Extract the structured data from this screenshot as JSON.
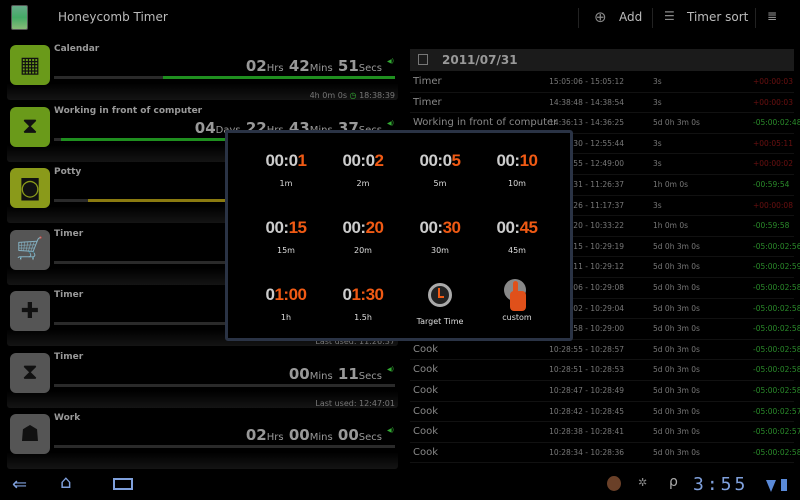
{
  "action_bar": {
    "title": "Honeycomb Timer",
    "add_label": "Add",
    "sort_label": "Timer sort"
  },
  "timers": [
    {
      "name": "Calendar",
      "icon": "calendar-icon",
      "color": "#6a9a1a",
      "parts": [
        [
          "02",
          "Hrs"
        ],
        [
          "42",
          "Mins"
        ],
        [
          "51",
          "Secs"
        ]
      ],
      "progress": 0.68,
      "bar_color": "#1f8f1f",
      "footer_left": "4h 0m 0s",
      "footer_right": "18:38:39"
    },
    {
      "name": "Working in front of computer",
      "icon": "hourglass-icon",
      "color": "#6a9a1a",
      "parts": [
        [
          "04",
          "Days"
        ],
        [
          "22",
          "Hrs"
        ],
        [
          "43",
          "Mins"
        ],
        [
          "37",
          "Secs"
        ]
      ],
      "progress": 0.98,
      "bar_color": "#1f8f1f",
      "footer_left": "",
      "footer_right": ""
    },
    {
      "name": "Potty",
      "icon": "toilet-paper-icon",
      "color": "#8a9a1a",
      "parts": [],
      "progress": 0.9,
      "bar_color": "#8a7a10",
      "footer_left": "",
      "footer_right": ""
    },
    {
      "name": "Timer",
      "icon": "cart-icon",
      "color": "#555",
      "parts": [],
      "progress": 0,
      "bar_color": "#333",
      "footer_left": "",
      "footer_right": ""
    },
    {
      "name": "Timer",
      "icon": "first-aid-kit-icon",
      "color": "#555",
      "parts": [],
      "progress": 0,
      "bar_color": "#333",
      "footer_left": "",
      "footer_right": "Last used: 11:26:37"
    },
    {
      "name": "Timer",
      "icon": "hourglass-icon",
      "color": "#555",
      "parts": [
        [
          "00",
          "Mins"
        ],
        [
          "11",
          "Secs"
        ]
      ],
      "progress": 0,
      "bar_color": "#333",
      "footer_left": "",
      "footer_right": "Last used: 12:47:01"
    },
    {
      "name": "Work",
      "icon": "worker-icon",
      "color": "#555",
      "parts": [
        [
          "02",
          "Hrs"
        ],
        [
          "00",
          "Mins"
        ],
        [
          "00",
          "Secs"
        ]
      ],
      "progress": 0,
      "bar_color": "#333",
      "footer_left": "",
      "footer_right": ""
    }
  ],
  "log": {
    "date": "2011/07/31",
    "rows": [
      [
        "Timer",
        "15:05:06 - 15:05:12",
        "3s",
        "+00:00:03",
        "red"
      ],
      [
        "Timer",
        "14:38:48 - 14:38:54",
        "3s",
        "+00:00:03",
        "red"
      ],
      [
        "Working in front of computer",
        "14:36:13 - 14:36:25",
        "5d 0h 3m 0s",
        "-05:00:02:48",
        "green"
      ],
      [
        "",
        ":30 - 12:55:44",
        "3s",
        "+00:05:11",
        "red"
      ],
      [
        "",
        "55 - 12:49:00",
        "3s",
        "+00:00:02",
        "red"
      ],
      [
        "",
        ":31 - 11:26:37",
        "1h 0m 0s",
        "-00:59:54",
        "green"
      ],
      [
        "",
        ":26 - 11:17:37",
        "3s",
        "+00:00:08",
        "red"
      ],
      [
        "",
        ":20 - 10:33:22",
        "1h 0m 0s",
        "-00:59:58",
        "green"
      ],
      [
        "",
        ":15 - 10:29:19",
        "5d 0h 3m 0s",
        "-05:00:02:56",
        "green"
      ],
      [
        "",
        ":11 - 10:29:12",
        "5d 0h 3m 0s",
        "-05:00:02:59",
        "green"
      ],
      [
        "",
        ":06 - 10:29:08",
        "5d 0h 3m 0s",
        "-05:00:02:58",
        "green"
      ],
      [
        "",
        ":02 - 10:29:04",
        "5d 0h 3m 0s",
        "-05:00:02:58",
        "green"
      ],
      [
        "",
        ":58 - 10:29:00",
        "5d 0h 3m 0s",
        "-05:00:02:58",
        "green"
      ],
      [
        "Cook",
        "10:28:55 - 10:28:57",
        "5d 0h 3m 0s",
        "-05:00:02:58",
        "green"
      ],
      [
        "Cook",
        "10:28:51 - 10:28:53",
        "5d 0h 3m 0s",
        "-05:00:02:58",
        "green"
      ],
      [
        "Cook",
        "10:28:47 - 10:28:49",
        "5d 0h 3m 0s",
        "-05:00:02:58",
        "green"
      ],
      [
        "Cook",
        "10:28:42 - 10:28:45",
        "5d 0h 3m 0s",
        "-05:00:02:57",
        "green"
      ],
      [
        "Cook",
        "10:28:38 - 10:28:41",
        "5d 0h 3m 0s",
        "-05:00:02:57",
        "green"
      ],
      [
        "Cook",
        "10:28:34 - 10:28:36",
        "5d 0h 3m 0s",
        "-05:00:02:58",
        "green"
      ]
    ]
  },
  "colors": {
    "red": "#6a1010",
    "green": "#2a8a2a",
    "accent": "#f05a14"
  },
  "dialog": {
    "presets": [
      {
        "gray": "00:0",
        "orange": "1",
        "label": "1m"
      },
      {
        "gray": "00:0",
        "orange": "2",
        "label": "2m"
      },
      {
        "gray": "00:0",
        "orange": "5",
        "label": "5m"
      },
      {
        "gray": "00:",
        "orange": "10",
        "label": "10m"
      },
      {
        "gray": "00:",
        "orange": "15",
        "label": "15m"
      },
      {
        "gray": "00:",
        "orange": "20",
        "label": "20m"
      },
      {
        "gray": "00:",
        "orange": "30",
        "label": "30m"
      },
      {
        "gray": "00:",
        "orange": "45",
        "label": "45m"
      },
      {
        "gray": "0",
        "orange": "1:00",
        "label": "1h"
      },
      {
        "gray": "0",
        "orange": "1:30",
        "label": "1.5h"
      }
    ],
    "target_label": "Target Time",
    "custom_label": "custom"
  },
  "status": {
    "clock": "3:55"
  }
}
